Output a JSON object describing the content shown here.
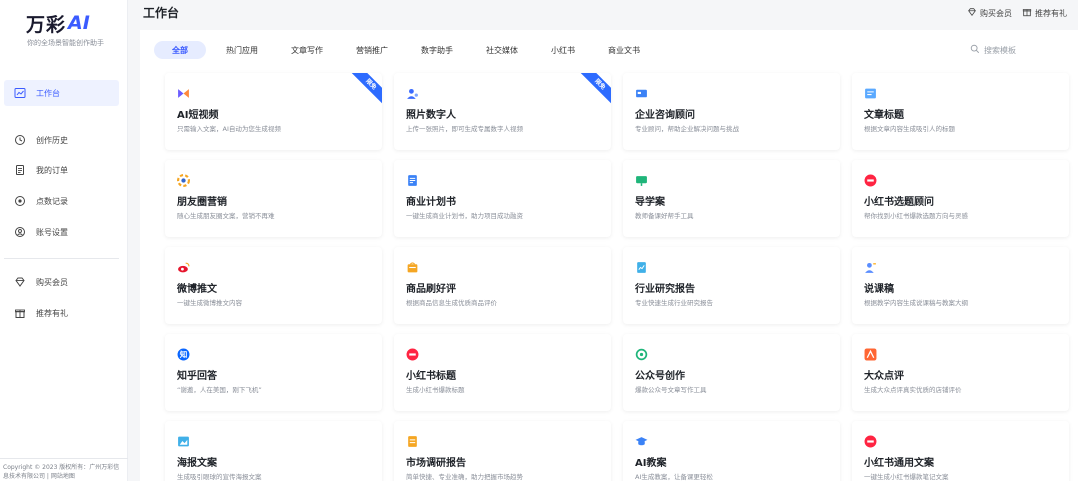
{
  "brand": {
    "name": "万彩",
    "ai": "AI",
    "slogan": "你的全场景智能创作助手"
  },
  "sidebar": {
    "items": [
      {
        "label": "工作台",
        "icon": "chart-line-icon"
      },
      {
        "label": "创作历史",
        "icon": "history-icon"
      },
      {
        "label": "我的订单",
        "icon": "order-icon"
      },
      {
        "label": "点数记录",
        "icon": "points-icon"
      },
      {
        "label": "账号设置",
        "icon": "account-icon"
      },
      {
        "label": "购买会员",
        "icon": "diamond-icon"
      },
      {
        "label": "推荐有礼",
        "icon": "gift-icon"
      }
    ],
    "copyright": "Copyright © 2023 版权所有：广州万彩信息技术有限公司 | 网站地图"
  },
  "header": {
    "title": "工作台",
    "buy_member": "购买会员",
    "recommend": "推荐有礼"
  },
  "tabs": [
    "全部",
    "热门应用",
    "文章写作",
    "营销推广",
    "数字助手",
    "社交媒体",
    "小红书",
    "商业文书"
  ],
  "search": {
    "placeholder": "搜索模板"
  },
  "cards": [
    {
      "title": "AI短视频",
      "desc": "只需输入文案，AI自动为您生成视频",
      "badge": "限免",
      "icon": "video-icon",
      "color": "#6b5cff"
    },
    {
      "title": "照片数字人",
      "desc": "上传一张照片，即可生成专属数字人视频",
      "badge": "限免",
      "icon": "digital-human-icon",
      "color": "#3b6bff"
    },
    {
      "title": "企业咨询顾问",
      "desc": "专业顾问，帮助企业解决问题与挑战",
      "badge": "",
      "icon": "consult-icon",
      "color": "#3b82f6"
    },
    {
      "title": "文章标题",
      "desc": "根据文章内容生成吸引人的标题",
      "badge": "",
      "icon": "title-icon",
      "color": "#5aa9ff"
    },
    {
      "title": "朋友圈营销",
      "desc": "随心生成朋友圈文案，营销不再难",
      "badge": "",
      "icon": "moments-icon",
      "color": "#f5a623"
    },
    {
      "title": "商业计划书",
      "desc": "一键生成商业计划书，助力项目成功融资",
      "badge": "",
      "icon": "plan-icon",
      "color": "#3b82f6"
    },
    {
      "title": "导学案",
      "desc": "教师备课好帮手工具",
      "badge": "",
      "icon": "lesson-icon",
      "color": "#1fb57a"
    },
    {
      "title": "小红书选题顾问",
      "desc": "帮你找到小红书爆款选题方向与灵感",
      "badge": "",
      "icon": "xhs-topic-icon",
      "color": "#ff2442"
    },
    {
      "title": "微博推文",
      "desc": "一键生成微博推文内容",
      "badge": "",
      "icon": "weibo-icon",
      "color": "#e6162d"
    },
    {
      "title": "商品刷好评",
      "desc": "根据商品信息生成优质商品评价",
      "badge": "",
      "icon": "review-icon",
      "color": "#f5a623"
    },
    {
      "title": "行业研究报告",
      "desc": "专业快速生成行业研究报告",
      "badge": "",
      "icon": "report-icon",
      "color": "#40b0e8"
    },
    {
      "title": "说课稿",
      "desc": "根据教学内容生成说课稿与教案大纲",
      "badge": "",
      "icon": "speech-icon",
      "color": "#5a8dff"
    },
    {
      "title": "知乎回答",
      "desc": "“谢邀，人在美国，刚下飞机”",
      "badge": "",
      "icon": "zhihu-icon",
      "color": "#0a66ff"
    },
    {
      "title": "小红书标题",
      "desc": "生成小红书爆款标题",
      "badge": "",
      "icon": "xhs-title-icon",
      "color": "#ff2442"
    },
    {
      "title": "公众号创作",
      "desc": "爆款公众号文章写作工具",
      "badge": "",
      "icon": "wechat-icon",
      "color": "#1fb57a"
    },
    {
      "title": "大众点评",
      "desc": "生成大众点评真实优质的店铺评价",
      "badge": "",
      "icon": "dianping-icon",
      "color": "#ff6633"
    },
    {
      "title": "海报文案",
      "desc": "生成吸引眼球的宣传海报文案",
      "badge": "",
      "icon": "poster-icon",
      "color": "#40b0e8"
    },
    {
      "title": "市场调研报告",
      "desc": "简单快捷、专业准确，助力把握市场趋势",
      "badge": "",
      "icon": "survey-icon",
      "color": "#f5a623"
    },
    {
      "title": "AI教案",
      "desc": "AI生成教案，让备课更轻松",
      "badge": "",
      "icon": "teach-icon",
      "color": "#3b82f6"
    },
    {
      "title": "小红书通用文案",
      "desc": "一键生成小红书爆款笔记文案",
      "badge": "",
      "icon": "xhs-copy-icon",
      "color": "#ff2442"
    }
  ]
}
